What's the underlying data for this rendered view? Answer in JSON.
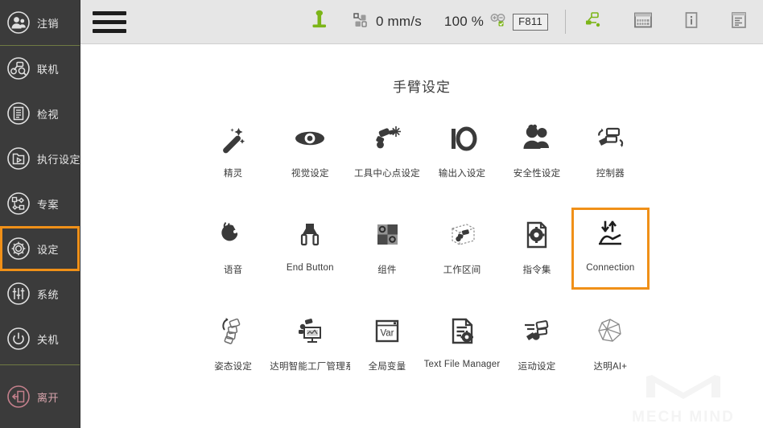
{
  "sidebar": {
    "items": [
      {
        "id": "logout",
        "label": "注销",
        "icon": "user-logout-icon",
        "selected": false,
        "accent": "#e6e6e6"
      },
      {
        "id": "connect",
        "label": "联机",
        "icon": "robot-link-icon",
        "selected": false,
        "accent": "#e6e6e6"
      },
      {
        "id": "view",
        "label": "检视",
        "icon": "document-view-icon",
        "selected": false,
        "accent": "#e6e6e6"
      },
      {
        "id": "run",
        "label": "执行设定",
        "icon": "folder-run-icon",
        "selected": false,
        "accent": "#e6e6e6"
      },
      {
        "id": "project",
        "label": "专案",
        "icon": "flowchart-icon",
        "selected": false,
        "accent": "#e6e6e6"
      },
      {
        "id": "setting",
        "label": "设定",
        "icon": "gear-icon",
        "selected": true,
        "accent": "#e6e6e6"
      },
      {
        "id": "system",
        "label": "系统",
        "icon": "sliders-icon",
        "selected": false,
        "accent": "#e6e6e6"
      },
      {
        "id": "shutdown",
        "label": "关机",
        "icon": "power-icon",
        "selected": false,
        "accent": "#e6e6e6"
      },
      {
        "id": "exit",
        "label": "离开",
        "icon": "exit-door-icon",
        "selected": false,
        "accent": "#c4808c"
      }
    ]
  },
  "toolbar": {
    "menu_icon": "hamburger-menu-icon",
    "joystick_icon": "joystick-icon",
    "speed_icon": "robot-speed-icon",
    "speed_value": "0 mm/s",
    "percent_value": "100 %",
    "zoom_icon": "zoom-in-out-icon",
    "firmware_badge": "F811",
    "node_icon": "robot-node-icon",
    "keypad_icon": "keypad-icon",
    "info_icon": "info-icon",
    "log_icon": "log-document-icon"
  },
  "main": {
    "title": "手臂设定",
    "tiles": [
      {
        "id": "wizard",
        "label": "精灵",
        "icon": "magic-wand-icon",
        "selected": false
      },
      {
        "id": "vision",
        "label": "视觉设定",
        "icon": "eye-icon",
        "selected": false
      },
      {
        "id": "tcp",
        "label": "工具中心点设定",
        "icon": "tcp-robot-icon",
        "selected": false
      },
      {
        "id": "io",
        "label": "输出入设定",
        "icon": "io-icon",
        "selected": false
      },
      {
        "id": "safety",
        "label": "安全性设定",
        "icon": "people-icon",
        "selected": false
      },
      {
        "id": "controller",
        "label": "控制器",
        "icon": "controller-icon",
        "selected": false
      },
      {
        "id": "voice",
        "label": "语音",
        "icon": "voice-icon",
        "selected": false
      },
      {
        "id": "endbutton",
        "label": "End Button",
        "icon": "end-effector-icon",
        "selected": false
      },
      {
        "id": "component",
        "label": "组件",
        "icon": "component-icon",
        "selected": false
      },
      {
        "id": "workspace",
        "label": "工作区间",
        "icon": "workspace-cube-icon",
        "selected": false
      },
      {
        "id": "commandset",
        "label": "指令集",
        "icon": "gear-document-icon",
        "selected": false
      },
      {
        "id": "connection",
        "label": "Connection",
        "icon": "connection-icon",
        "selected": true
      },
      {
        "id": "posture",
        "label": "姿态设定",
        "icon": "posture-icon",
        "selected": false
      },
      {
        "id": "tmfactory",
        "label": "达明智能工厂管理系",
        "icon": "factory-monitor-icon",
        "selected": false
      },
      {
        "id": "globalvar",
        "label": "全局变量",
        "icon": "var-window-icon",
        "selected": false
      },
      {
        "id": "textfile",
        "label": "Text File Manager",
        "icon": "file-gear-icon",
        "selected": false
      },
      {
        "id": "motion",
        "label": "运动设定",
        "icon": "motion-robot-icon",
        "selected": false
      },
      {
        "id": "aiplus",
        "label": "达明AI+",
        "icon": "ai-brain-icon",
        "selected": false
      }
    ]
  },
  "watermark": {
    "text": "MECH MIND",
    "icon": "mech-mind-logo"
  },
  "colors": {
    "sidebar_bg": "#3b3b3b",
    "toolbar_bg": "#e6e6e6",
    "content_bg": "#ffffff",
    "accent_orange": "#f09018",
    "accent_green": "#7cb518",
    "divider_green": "#6f7a44",
    "exit_red": "#c4808c",
    "icon_dark": "#3a3a3a"
  }
}
